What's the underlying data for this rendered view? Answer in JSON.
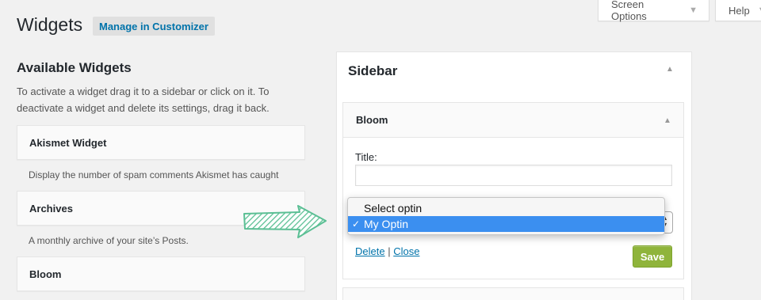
{
  "header": {
    "title": "Widgets",
    "customizer_button": "Manage in Customizer",
    "screen_options": "Screen Options",
    "help": "Help"
  },
  "available": {
    "heading": "Available Widgets",
    "description": "To activate a widget drag it to a sidebar or click on it. To deactivate a widget and delete its settings, drag it back.",
    "widgets": [
      {
        "name": "Akismet Widget",
        "description": "Display the number of spam comments Akismet has caught"
      },
      {
        "name": "Archives",
        "description": "A monthly archive of your site’s Posts."
      },
      {
        "name": "Bloom",
        "description": ""
      }
    ]
  },
  "sidebar": {
    "title": "Sidebar",
    "widget": {
      "name": "Bloom",
      "title_label": "Title:",
      "title_value": "",
      "optin_options": [
        {
          "label": "Select optin",
          "selected": false
        },
        {
          "label": "My Optin",
          "selected": true
        }
      ],
      "delete_label": "Delete",
      "separator": "|",
      "close_label": "Close",
      "save_label": "Save"
    }
  },
  "icons": {
    "collapse": "arrow-up-icon",
    "dropdown": "caret-down-icon",
    "checkmark": "checkmark-icon",
    "pointer": "green-hatched-arrow-icon"
  },
  "colors": {
    "accent": "#0073aa",
    "save": "#8fb43b",
    "selection": "#3b8ff0",
    "arrow": "#5bbf94"
  }
}
